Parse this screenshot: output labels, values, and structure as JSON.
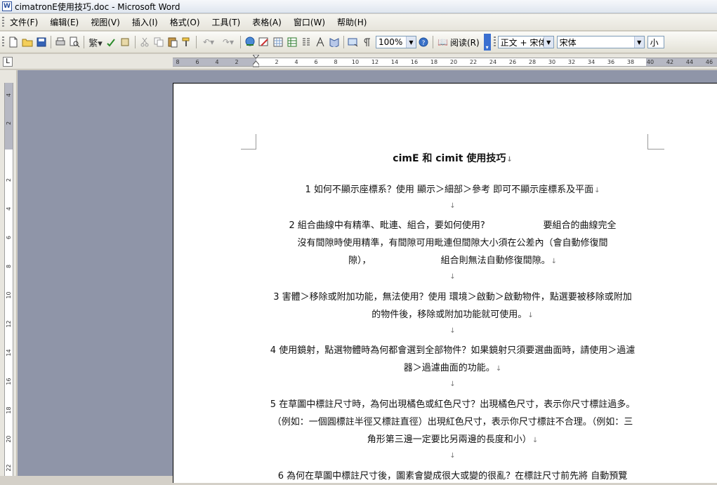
{
  "window": {
    "title": "cimatronE使用技巧.doc - Microsoft Word",
    "app_icon": "W"
  },
  "menu": [
    "文件(F)",
    "编辑(E)",
    "视图(V)",
    "插入(I)",
    "格式(O)",
    "工具(T)",
    "表格(A)",
    "窗口(W)",
    "帮助(H)"
  ],
  "toolbar": {
    "zoom": "100%",
    "read_label": "阅读(R)",
    "style": "正文 + 宋体",
    "font": "宋体",
    "size": "小"
  },
  "ruler": {
    "h_ticks": [
      "8",
      "6",
      "4",
      "2",
      "2",
      "4",
      "6",
      "8",
      "10",
      "12",
      "14",
      "16",
      "18",
      "20",
      "22",
      "24",
      "26",
      "28",
      "30",
      "32",
      "34",
      "36",
      "38",
      "40",
      "42",
      "44",
      "46"
    ],
    "v_ticks": [
      "4",
      "2",
      "2",
      "4",
      "6",
      "8",
      "10",
      "12",
      "14",
      "16",
      "18",
      "20",
      "22"
    ]
  },
  "document": {
    "title": "cimE 和 cimit 使用技巧",
    "paragraphs": [
      [
        "1 如何不顯示座標系？使用 顯示＞細部＞參考 即可不顯示座標系及平面"
      ],
      [
        "2 組合曲線中有精準、毗連、組合，要如何使用?                    要組合的曲線完全",
        "沒有間隙時使用精準，有間隙可用毗連但間隙大小須在公差內（會自動修復間",
        "隙），                        組合則無法自動修復間隙。"
      ],
      [
        "3 害體＞移除或附加功能，無法使用？使用 環境＞啟動＞啟動物件，點選要被移除或附加",
        "的物件後，移除或附加功能就可使用。"
      ],
      [
        "4 使用鏡射，點選物體時為何都會選到全部物件？如果鏡射只須要選曲面時，請使用＞過濾",
        "器＞過濾曲面的功能。"
      ],
      [
        "5 在草圖中標註尺寸時，為何出現橘色或紅色尺寸？出現橘色尺寸，表示你尺寸標註過多。",
        "（例如：一個圓標註半徑又標註直徑）出現紅色尺寸，表示你尺寸標註不合理。（例如：三",
        "角形第三邊一定要比另兩邊的長度和小）"
      ],
      [
        "6 為何在草圖中標註尺寸後，圖素會變成很大或變的很亂？在標註尺寸前先將 自動預覽"
      ]
    ],
    "para_mark": "↓"
  }
}
